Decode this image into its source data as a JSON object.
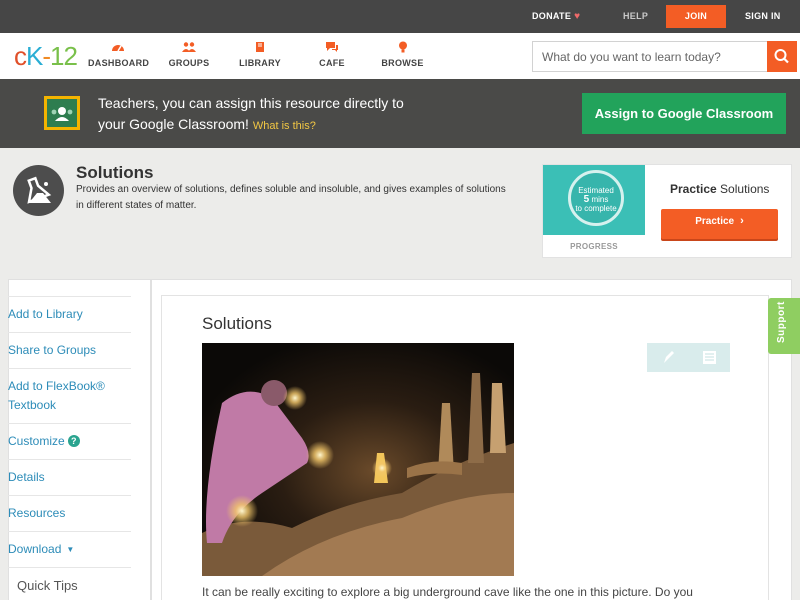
{
  "topbar": {
    "donate": "DONATE",
    "help": "HELP",
    "join": "JOIN",
    "signin": "SIGN IN"
  },
  "nav": {
    "logo": {
      "c": "c",
      "k": "K",
      "dash": "-",
      "n": "12"
    },
    "items": [
      {
        "label": "DASHBOARD",
        "icon": "dashboard-icon"
      },
      {
        "label": "GROUPS",
        "icon": "groups-icon"
      },
      {
        "label": "LIBRARY",
        "icon": "library-icon"
      },
      {
        "label": "CAFE",
        "icon": "cafe-icon"
      },
      {
        "label": "BROWSE",
        "icon": "browse-icon"
      }
    ],
    "search_placeholder": "What do you want to learn today?"
  },
  "banner": {
    "text_line1": "Teachers, you can assign this resource directly to",
    "text_line2": "your Google Classroom!",
    "link": "What is this?",
    "button": "Assign to Google Classroom"
  },
  "concept": {
    "title": "Solutions",
    "description": "Provides an overview of solutions, defines soluble and insoluble, and gives examples of solutions in different states of matter."
  },
  "practice": {
    "estimated_line1": "Estimated",
    "estimated_mins": "5",
    "estimated_line2": "mins",
    "estimated_line3": "to complete",
    "progress": "PROGRESS",
    "title_bold": "Practice",
    "title_rest": "Solutions",
    "button": "Practice"
  },
  "sidebar": {
    "items": [
      {
        "label": "Add to Library"
      },
      {
        "label": "Share to Groups"
      },
      {
        "label": "Add to FlexBook® Textbook"
      },
      {
        "label": "Customize"
      },
      {
        "label": "Details"
      },
      {
        "label": "Resources"
      },
      {
        "label": "Download"
      }
    ],
    "quick_tips": "Quick Tips"
  },
  "main": {
    "title": "Solutions",
    "paragraph": "It can be really exciting to explore a big underground cave like the one in this picture. Do you"
  },
  "support": "Support",
  "colors": {
    "accent": "#f35d25",
    "google_green": "#22a35b",
    "link": "#2d8cb8",
    "teal": "#3bbfb6"
  }
}
